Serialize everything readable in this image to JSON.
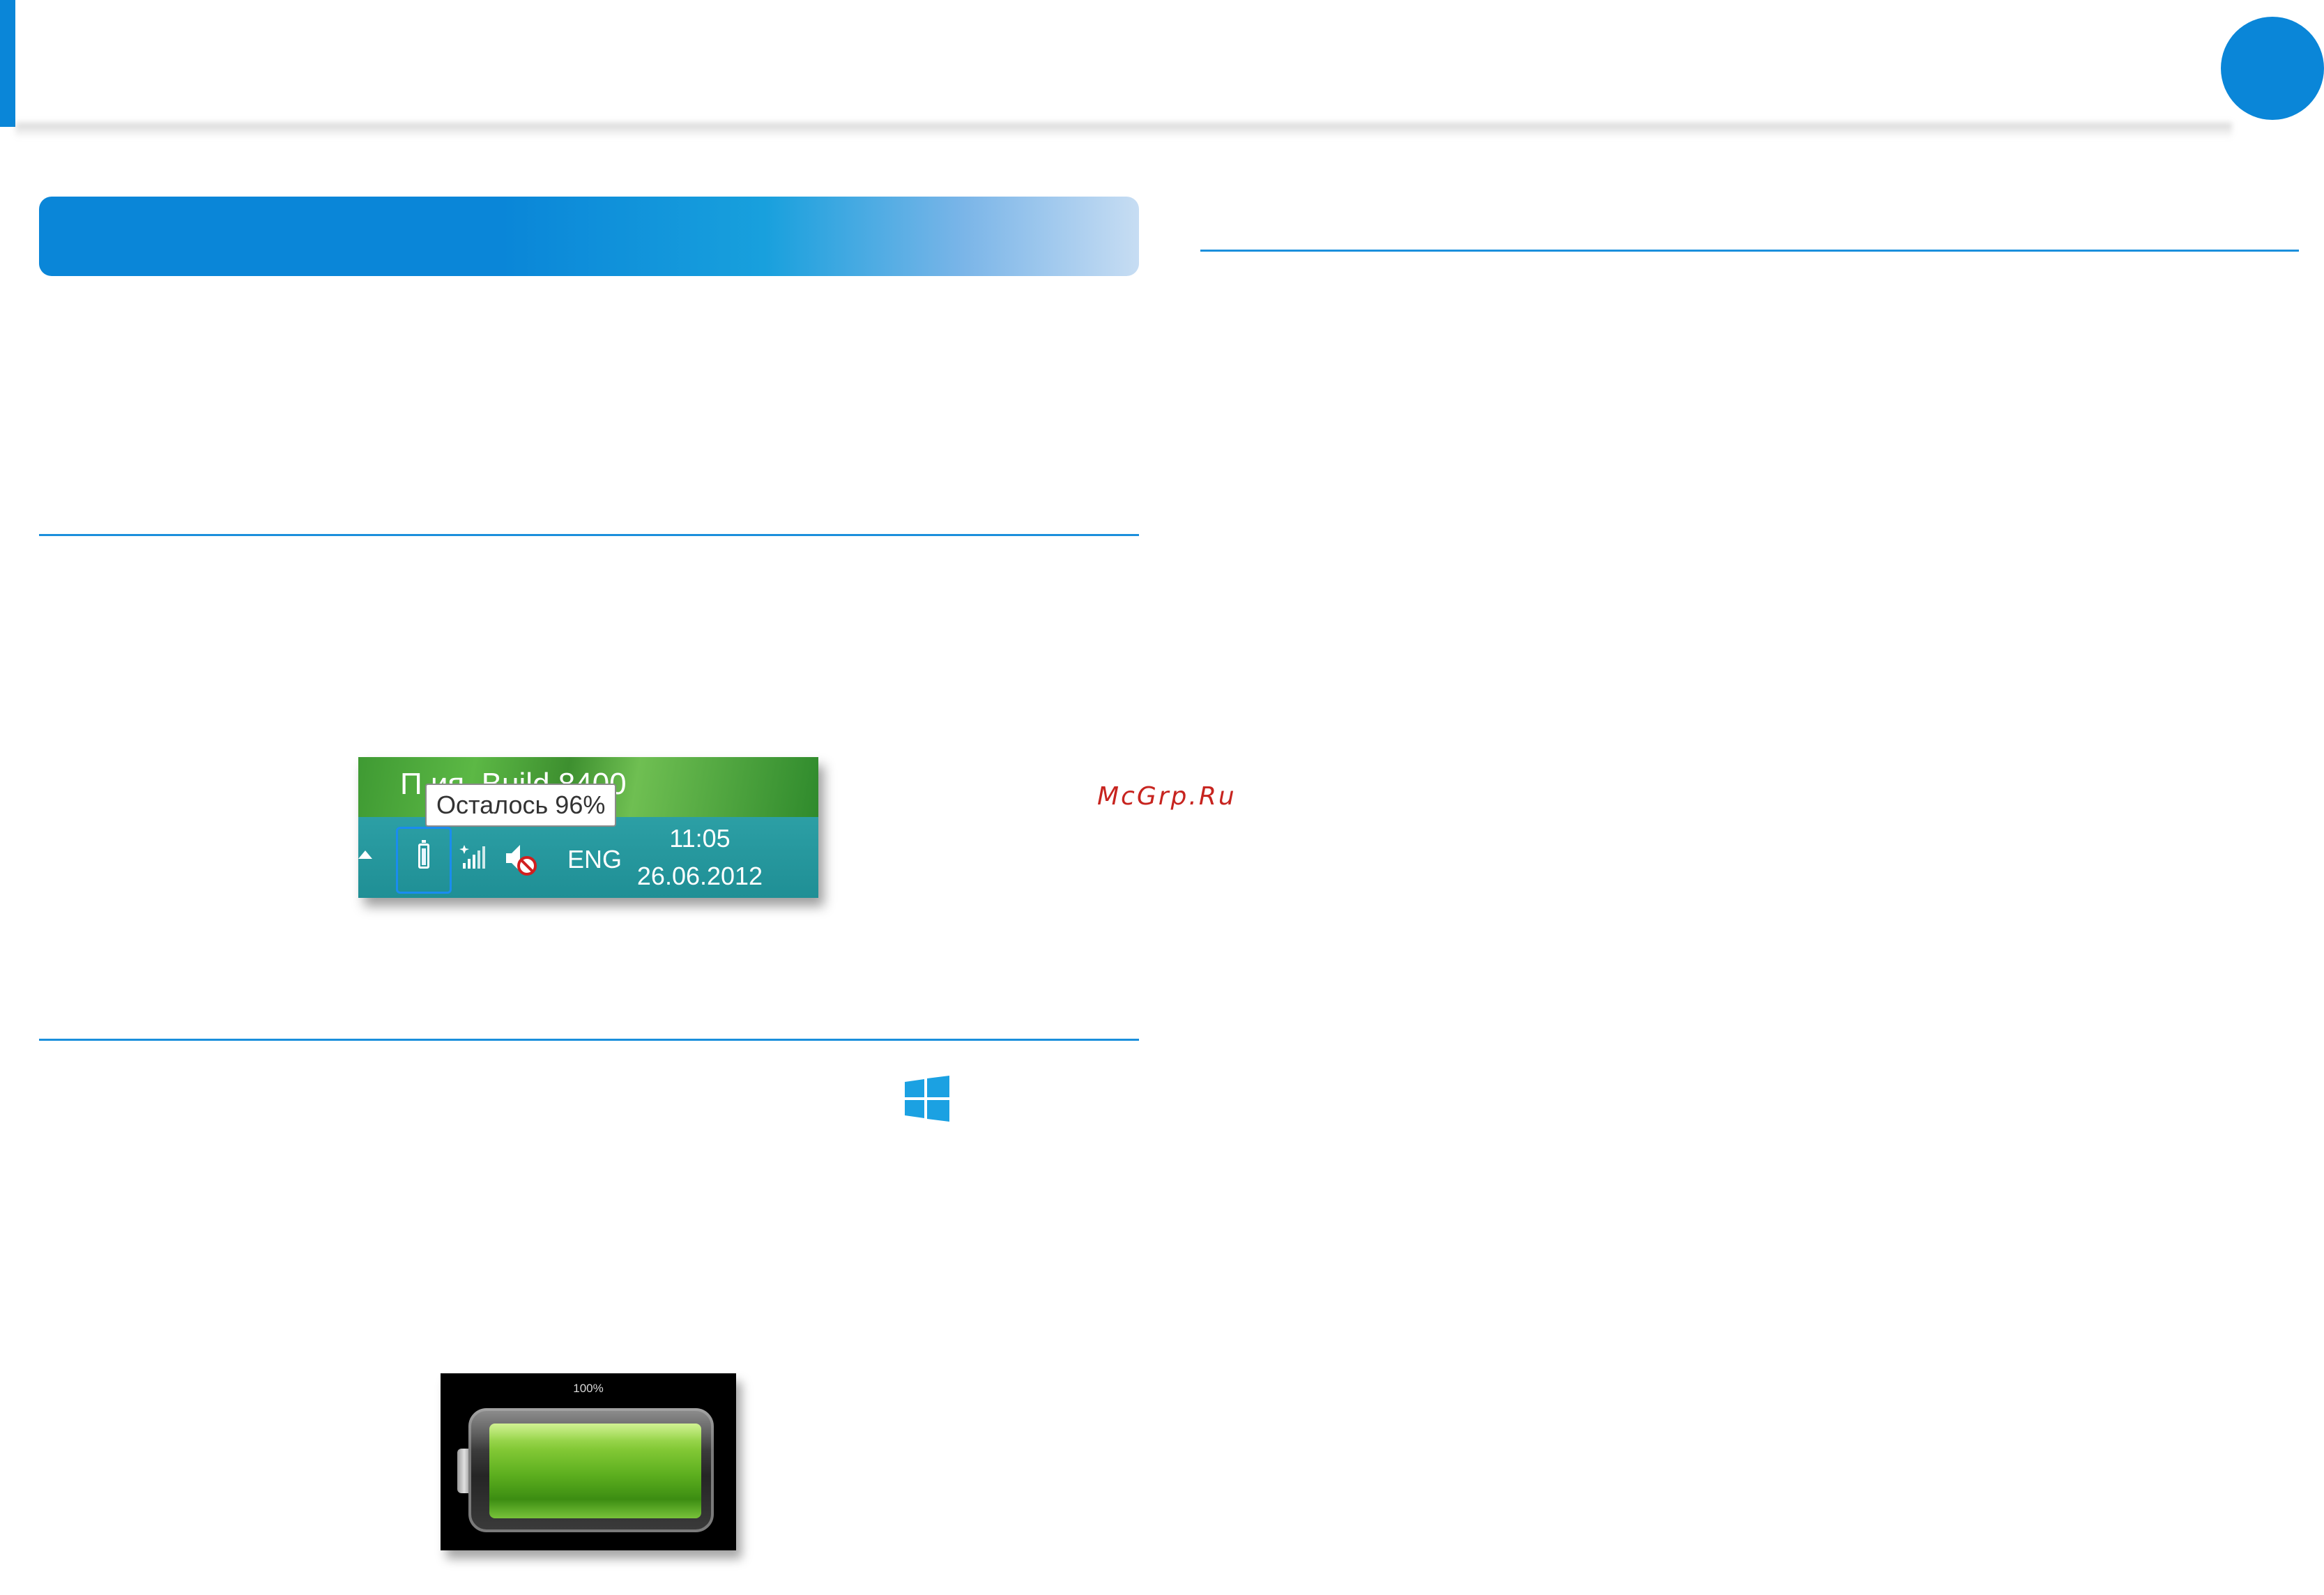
{
  "header": {
    "accent_color": "#0a86d8"
  },
  "taskbar_screenshot": {
    "wallpaper_text": "П        ия. Build 8400",
    "tooltip": "Осталось 96%",
    "tray_icons": [
      "battery-icon",
      "network-icon",
      "volume-muted-icon"
    ],
    "language": "ENG",
    "time": "11:05",
    "date": "26.06.2012",
    "taskbar_color": "#2298a0",
    "highlight_color": "#1a8cf0"
  },
  "watermark": "McGrp.Ru",
  "windows_logo": {
    "icon": "windows-logo-icon",
    "color": "#1ba1e2"
  },
  "battery_screen": {
    "percent_label": "100%",
    "charge_level": 1.0,
    "fill_color": "#6dbb2a"
  }
}
